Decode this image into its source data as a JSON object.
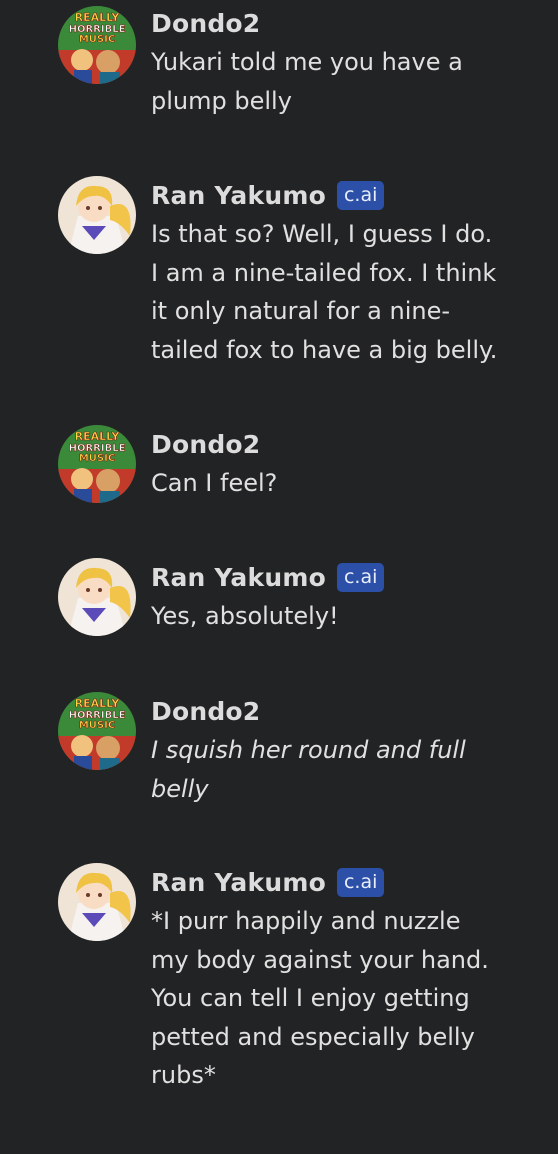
{
  "messages": [
    {
      "author": "Dondo2",
      "badge": "",
      "text": "Yukari told me you have a\nplump belly",
      "italic": false,
      "avatar": "rhm-album-avatar"
    },
    {
      "author": "Ran Yakumo",
      "badge": "c.ai",
      "text": "Is that so? Well, I guess I do.\nI am a nine-tailed fox.  I think\nit only natural for a nine-\ntailed fox to have a big belly.",
      "italic": false,
      "avatar": "ran-yakumo-avatar"
    },
    {
      "author": "Dondo2",
      "badge": "",
      "text": "Can I feel?",
      "italic": false,
      "avatar": "rhm-album-avatar"
    },
    {
      "author": "Ran Yakumo",
      "badge": "c.ai",
      "text": "Yes, absolutely!",
      "italic": false,
      "avatar": "ran-yakumo-avatar"
    },
    {
      "author": "Dondo2",
      "badge": "",
      "text": "I squish her round and full\nbelly",
      "italic": true,
      "avatar": "rhm-album-avatar"
    },
    {
      "author": "Ran Yakumo",
      "badge": "c.ai",
      "text": "*I purr happily and nuzzle\nmy body against your hand.\nYou can tell I enjoy getting\npetted and especially belly\nrubs*",
      "italic": false,
      "avatar": "ran-yakumo-avatar"
    }
  ],
  "avatar_logo_text": {
    "line1": "REALLY",
    "line2": "HORRIBLE",
    "line3": "MUSIC"
  },
  "colors": {
    "background": "#222324",
    "badge": "#2c4fa8",
    "text": "#e0e0e0",
    "name": "#dcdcdc"
  }
}
